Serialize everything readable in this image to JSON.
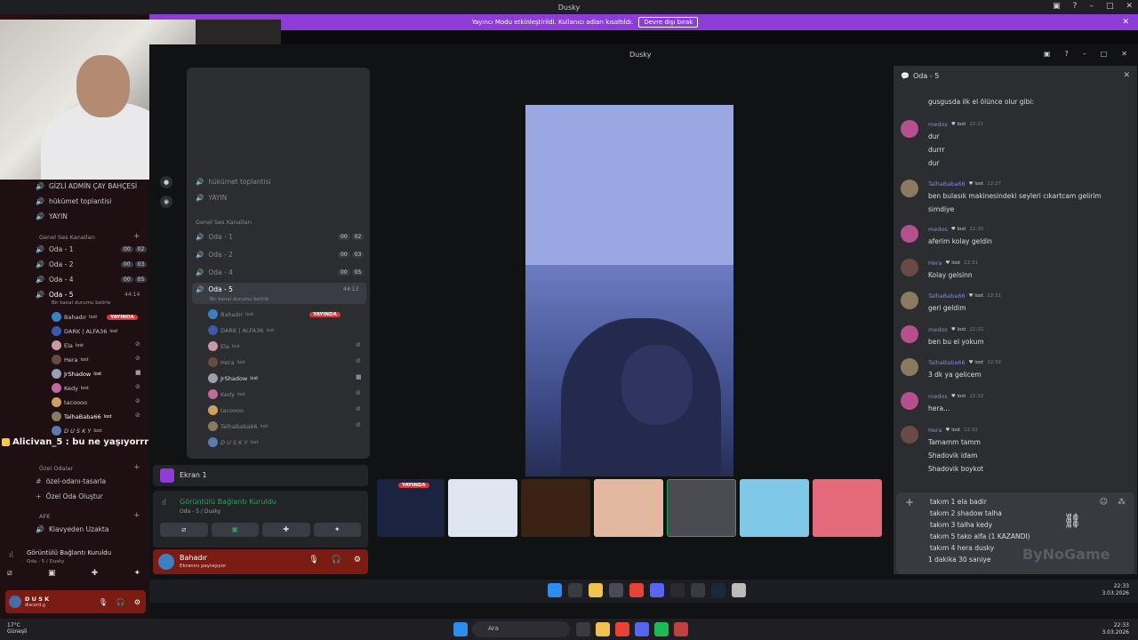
{
  "window": {
    "title": "Dusky"
  },
  "banner": {
    "text": "Yayıncı Modu etkinleştirildi. Kullanıcı adları kısaltıldı.",
    "button": "Devre dışı bırak"
  },
  "outer": {
    "channels": [
      {
        "name": "GİZLİ ADMİN ÇAY BAHÇESİ"
      },
      {
        "name": "hükümet toplantisi"
      },
      {
        "name": "YAYIN"
      }
    ],
    "voice_section": "Genel Ses Kanalları",
    "voice_channels": [
      {
        "name": "Oda - 1",
        "a": "00",
        "b": "02"
      },
      {
        "name": "Oda - 2",
        "a": "00",
        "b": "03"
      },
      {
        "name": "Oda - 4",
        "a": "00",
        "b": "05"
      },
      {
        "name": "Oda - 5",
        "a": "44:14",
        "b": ""
      }
    ],
    "status_line": "Bir kanal durumu belirle",
    "users": [
      {
        "name": "Bahadır",
        "badge": "lost",
        "live": "YAYINDA"
      },
      {
        "name": "DARK | ALFA36",
        "badge": "lost"
      },
      {
        "name": "Ela",
        "badge": "lost"
      },
      {
        "name": "Hera",
        "badge": "lost"
      },
      {
        "name": "JrShadow",
        "badge": "lost"
      },
      {
        "name": "Kedy",
        "badge": "lost"
      },
      {
        "name": "tacoooo",
        "badge": ""
      },
      {
        "name": "TalhaBaba66",
        "badge": "lost"
      },
      {
        "name": "D U S K Y",
        "badge": "lost"
      }
    ],
    "overlay_chat": "Alicivan_5 : bu ne yaşıyorrrr",
    "private_section": "Özel Odalar",
    "private_channels": [
      "özel-odanı-tasarla",
      "Özel Oda Oluştur"
    ],
    "afk_section": "AFK",
    "afk_channel": "Klavyeden Uzakta",
    "vc_title": "Görüntülü Bağlantı Kuruldu",
    "vc_sub": "Oda - 5 / Dusky",
    "self_name": "D U S K",
    "self_status": "discord.g"
  },
  "inner": {
    "title": "Dusky",
    "channels": [
      "hükümet toplantisi",
      "YAYIN"
    ],
    "voice_section": "Genel Ses Kanalları",
    "voice_channels": [
      {
        "name": "Oda - 1",
        "a": "00",
        "b": "02"
      },
      {
        "name": "Oda - 2",
        "a": "00",
        "b": "03"
      },
      {
        "name": "Oda - 4",
        "a": "00",
        "b": "05"
      },
      {
        "name": "Oda - 5",
        "a": "44:13",
        "b": ""
      }
    ],
    "status_line": "Bir kanal durumu belirle",
    "users": [
      {
        "name": "Bahadır",
        "badge": "lost",
        "live": "YAYINDA"
      },
      {
        "name": "DARK | ALFA36",
        "badge": "lost"
      },
      {
        "name": "Ela",
        "badge": "lost"
      },
      {
        "name": "Hera",
        "badge": "lost"
      },
      {
        "name": "JrShadow",
        "badge": "lost"
      },
      {
        "name": "Kedy",
        "badge": "lost"
      },
      {
        "name": "tacoooo",
        "badge": ""
      },
      {
        "name": "TalhaBaba66",
        "badge": "lost"
      },
      {
        "name": "D U S K Y",
        "badge": "lost"
      }
    ],
    "stream_title": "Ekran 1",
    "conn_title": "Görüntülü Bağlantı Kuruldu",
    "conn_sub": "Oda - 5 / Dusky",
    "me_name": "Bahadır",
    "me_status": "Ekranını paylaşıyor",
    "live_tag": "YAYINDA"
  },
  "chat": {
    "title": "Oda - 5",
    "top_line": "gusgusda ilk el ölünce olur gibi:",
    "messages": [
      {
        "author": "medos",
        "badge": "lost",
        "time": "22:21",
        "lines": [
          "dur",
          "durrr",
          "dur"
        ],
        "color": "#b64f8e"
      },
      {
        "author": "TalhaBaba66",
        "badge": "lost",
        "time": "22:27",
        "lines": [
          "ben bulasık makinesindeki seyleri cıkartcam gelirim",
          "simdiye"
        ],
        "color": "#8a7a60"
      },
      {
        "author": "medos",
        "badge": "lost",
        "time": "22:30",
        "lines": [
          "aferim kolay geldin"
        ],
        "color": "#b64f8e"
      },
      {
        "author": "Hera",
        "badge": "lost",
        "time": "22:31",
        "lines": [
          "Kolay gelsinn"
        ],
        "color": "#6a4a44"
      },
      {
        "author": "TalhaBaba66",
        "badge": "lost",
        "time": "22:31",
        "lines": [
          "geri geldim"
        ],
        "color": "#8a7a60"
      },
      {
        "author": "medos",
        "badge": "lost",
        "time": "22:32",
        "lines": [
          "ben bu el yokum"
        ],
        "color": "#b64f8e"
      },
      {
        "author": "TalhaBaba66",
        "badge": "lost",
        "time": "22:32",
        "lines": [
          "3 dk ya gelicem"
        ],
        "color": "#8a7a60"
      },
      {
        "author": "medos",
        "badge": "lost",
        "time": "22:32",
        "lines": [
          "hera..."
        ],
        "color": "#b64f8e"
      },
      {
        "author": "Hera",
        "badge": "lost",
        "time": "22:32",
        "lines": [
          "Tamamm tamm",
          "Shadovik idam",
          "Shadovik boykot"
        ],
        "color": "#6a4a44"
      }
    ],
    "compose_lines": [
      "takım 1 ela badir",
      "takım 2 shadow talha",
      "takım 3 talha kedy",
      "takım 5 tako alfa (1 KAZANDI)",
      "takım 4 hera dusky",
      "1 dakika 30 saniye"
    ],
    "watermark": "ByNoGame"
  },
  "inner_taskbar": {
    "time": "22:33",
    "date": "3.03.2026"
  },
  "taskbar": {
    "temp": "17°C",
    "weather": "Güneşli",
    "search": "Ara",
    "time": "22:33",
    "date": "3.03.2026"
  },
  "colors": {
    "accent": "#8c3dd6",
    "live": "#da373c",
    "online": "#23a55a"
  }
}
